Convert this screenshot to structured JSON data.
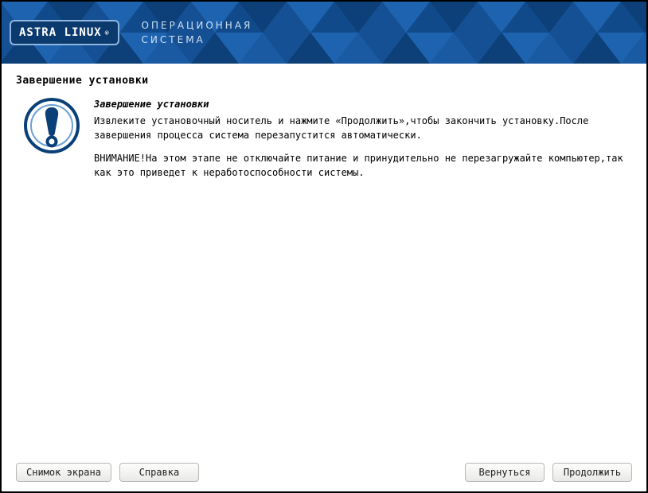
{
  "header": {
    "brand": "ASTRA LINUX",
    "brand_reg": "®",
    "line1": "ОПЕРАЦИОННАЯ",
    "line2": "СИСТЕМА"
  },
  "page": {
    "title": "Завершение установки",
    "subtitle": "Завершение установки",
    "paragraph1": "Извлеките установочный носитель и нажмите «Продолжить»,чтобы закончить установку.После завершения процесса система перезапустится автоматически.",
    "paragraph2": "ВНИМАНИЕ!На этом этапе не отключайте питание и принудительно не перезагружайте компьютер,так как это приведет к неработоспособности системы."
  },
  "buttons": {
    "screenshot": "Снимок экрана",
    "help": "Справка",
    "back": "Вернуться",
    "continue": "Продолжить"
  }
}
